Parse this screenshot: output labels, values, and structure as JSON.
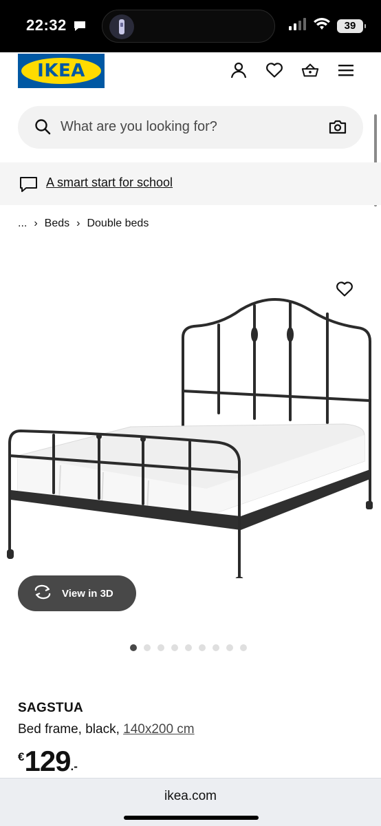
{
  "status_bar": {
    "time": "22:32",
    "battery": "39"
  },
  "header": {
    "logo_text": "IKEA",
    "icons": [
      "user-icon",
      "heart-icon",
      "basket-icon",
      "menu-icon"
    ]
  },
  "search": {
    "placeholder": "What are you looking for?"
  },
  "promo": {
    "text": "A smart start for school"
  },
  "breadcrumb": {
    "ellipsis": "...",
    "items": [
      "Beds",
      "Double beds"
    ]
  },
  "gallery": {
    "view3d_label": "View in 3D",
    "image_count": 9,
    "active_index": 0
  },
  "product": {
    "name": "SAGSTUA",
    "description": "Bed frame, black,",
    "size": "140x200 cm",
    "currency": "€",
    "price_int": "129",
    "price_dec": ".-"
  },
  "browser": {
    "url": "ikea.com"
  },
  "colors": {
    "ikea_blue": "#0058a3",
    "ikea_yellow": "#ffdb00"
  }
}
